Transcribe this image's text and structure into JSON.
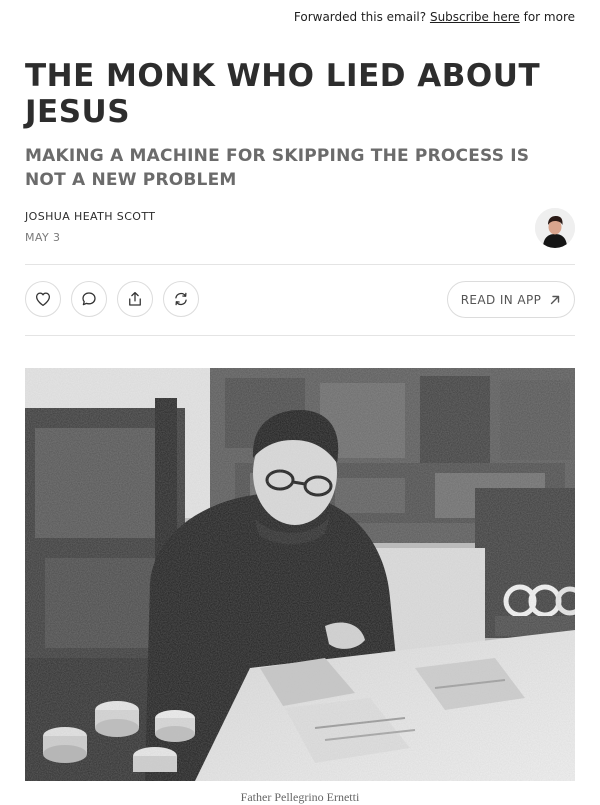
{
  "header": {
    "forward_prefix": "Forwarded this email?",
    "subscribe_link": "Subscribe here",
    "forward_suffix": "for more"
  },
  "post": {
    "title": "THE MONK WHO LIED ABOUT JESUS",
    "subtitle": "MAKING A MACHINE FOR SKIPPING THE PROCESS IS NOT A NEW PROBLEM",
    "author": "JOSHUA HEATH SCOTT",
    "date": "MAY 3"
  },
  "actions": {
    "like_icon": "heart-icon",
    "comment_icon": "comment-icon",
    "share_icon": "share-icon",
    "restack_icon": "restack-icon",
    "read_in_app_label": "READ IN APP",
    "read_in_app_icon": "arrow-up-right-icon"
  },
  "image": {
    "caption": "Father Pellegrino Ernetti"
  },
  "colors": {
    "text": "#2d2d2d",
    "muted": "#6b6b6b",
    "border": "#dcdcdc",
    "divider": "#e4e4e4"
  }
}
